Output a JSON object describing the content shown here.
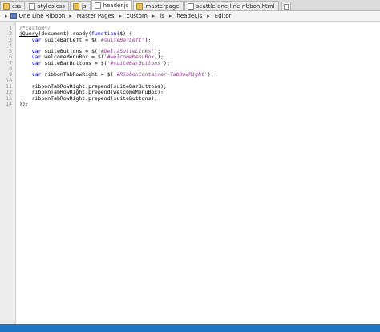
{
  "tabs": [
    {
      "label": "css",
      "icon": "folder-icon",
      "active": false
    },
    {
      "label": "styles.css",
      "icon": "file-icon",
      "active": false
    },
    {
      "label": "js",
      "icon": "folder-icon",
      "active": false
    },
    {
      "label": "header.js",
      "icon": "file-icon",
      "active": true
    },
    {
      "label": "masterpage",
      "icon": "folder-icon",
      "active": false
    },
    {
      "label": "seattle-one-line-ribbon.html",
      "icon": "file-icon",
      "active": false
    }
  ],
  "breadcrumb": [
    "One Line Ribbon",
    "Master Pages",
    "custom",
    "js",
    "header.js",
    "Editor"
  ],
  "editor": {
    "line_numbers": [
      "1",
      "2",
      "3",
      "4",
      "5",
      "6",
      "7",
      "8",
      "9",
      "10",
      "11",
      "12",
      "13",
      "14"
    ],
    "lines": [
      [
        {
          "t": "/*custom*/",
          "c": "cm"
        }
      ],
      [
        {
          "t": "jQuery",
          "c": "fn"
        },
        {
          "t": "(document).ready(",
          "c": ""
        },
        {
          "t": "function",
          "c": "kw"
        },
        {
          "t": "($) {",
          "c": ""
        }
      ],
      [
        {
          "t": "    ",
          "c": ""
        },
        {
          "t": "var",
          "c": "kw"
        },
        {
          "t": " suiteBarLeft = $(",
          "c": ""
        },
        {
          "t": "'#suiteBarLeft'",
          "c": "str"
        },
        {
          "t": ");",
          "c": ""
        }
      ],
      [
        {
          "t": "",
          "c": ""
        }
      ],
      [
        {
          "t": "    ",
          "c": ""
        },
        {
          "t": "var",
          "c": "kw"
        },
        {
          "t": " suiteButtons = $(",
          "c": ""
        },
        {
          "t": "'#DeltaSuiteLinks'",
          "c": "str"
        },
        {
          "t": ");",
          "c": ""
        }
      ],
      [
        {
          "t": "    ",
          "c": ""
        },
        {
          "t": "var",
          "c": "kw"
        },
        {
          "t": " welcomeMenuBox = $(",
          "c": ""
        },
        {
          "t": "'#welcomeMenuBox'",
          "c": "str"
        },
        {
          "t": ");",
          "c": ""
        }
      ],
      [
        {
          "t": "    ",
          "c": ""
        },
        {
          "t": "var",
          "c": "kw"
        },
        {
          "t": " suiteBarButtons = $(",
          "c": ""
        },
        {
          "t": "'#suiteBarButtons'",
          "c": "str"
        },
        {
          "t": ");",
          "c": ""
        }
      ],
      [
        {
          "t": "",
          "c": ""
        }
      ],
      [
        {
          "t": "    ",
          "c": ""
        },
        {
          "t": "var",
          "c": "kw"
        },
        {
          "t": " ribbonTabRowRight = $(",
          "c": ""
        },
        {
          "t": "'#RibbonContainer-TabRowRight'",
          "c": "str"
        },
        {
          "t": ");",
          "c": ""
        }
      ],
      [
        {
          "t": "",
          "c": ""
        }
      ],
      [
        {
          "t": "    ribbonTabRowRight.prepend(suiteBarButtons);",
          "c": ""
        }
      ],
      [
        {
          "t": "    ribbonTabRowRight.prepend(welcomeMenuBox);",
          "c": ""
        }
      ],
      [
        {
          "t": "    ribbonTabRowRight.prepend(suiteButtons);",
          "c": ""
        }
      ],
      [
        {
          "t": "});",
          "c": ""
        }
      ]
    ]
  },
  "colors": {
    "statusbar": "#1f74c5",
    "keyword": "#0000cc",
    "string": "#8a3a8a"
  }
}
